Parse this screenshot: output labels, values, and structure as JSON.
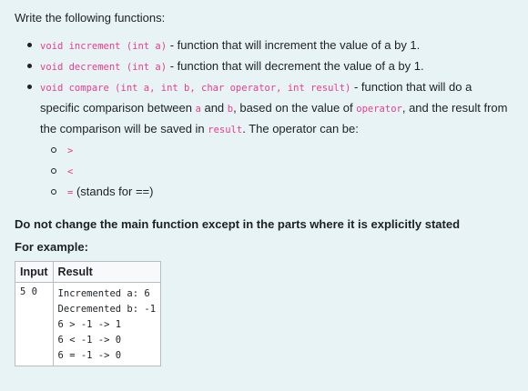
{
  "intro": "Write the following functions:",
  "functions": [
    {
      "code": "void increment (int a)",
      "text": " - function that will increment the value of a by 1."
    },
    {
      "code": "void decrement (int a)",
      "text": " - function that will decrement the value of a by 1."
    },
    {
      "code": "void compare (int a, int b, char operator, int result)",
      "text1": " - function that will do a specific comparison between ",
      "c1": "a",
      "text2": " and ",
      "c2": "b",
      "text3": ", based on the value of ",
      "c3": "operator",
      "text4": ", and the result from the comparison will be saved in ",
      "c4": "result",
      "text5": ". The operator can be:"
    }
  ],
  "operators": [
    {
      "code": ">",
      "text": ""
    },
    {
      "code": "<",
      "text": ""
    },
    {
      "code": "=",
      "text": " (stands for ==)"
    }
  ],
  "note": "Do not change the main function except in the parts where it is explicitly stated",
  "example_label": "For example:",
  "table": {
    "headers": [
      "Input",
      "Result"
    ],
    "input": "5 0",
    "result_lines": [
      "Incremented a: 6",
      "Decremented b: -1",
      "6 > -1 -> 1",
      "6 < -1 -> 0",
      "6 = -1 -> 0"
    ]
  }
}
